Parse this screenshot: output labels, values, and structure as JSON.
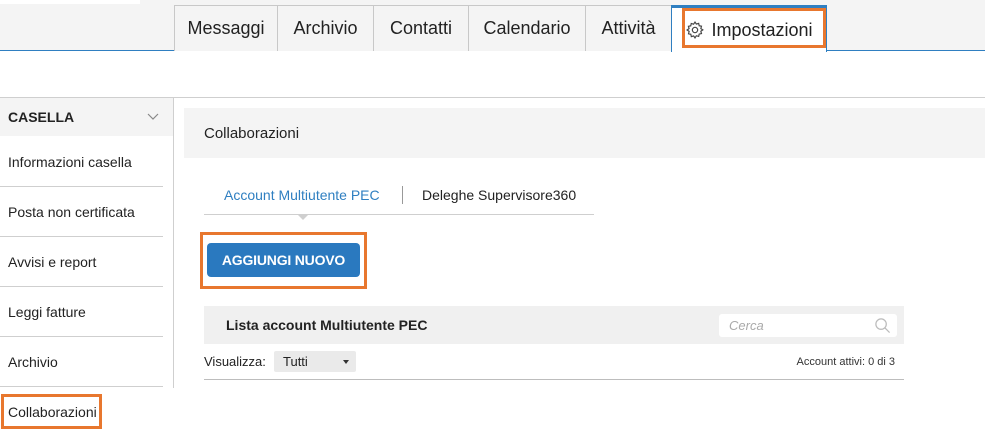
{
  "top_tabs": [
    {
      "label": "Messaggi"
    },
    {
      "label": "Archivio"
    },
    {
      "label": "Contatti"
    },
    {
      "label": "Calendario"
    },
    {
      "label": "Attività"
    },
    {
      "label": "Impostazioni",
      "icon": "gear-icon",
      "active": true
    }
  ],
  "sidebar": {
    "header": "CASELLA",
    "items": [
      {
        "label": "Informazioni casella"
      },
      {
        "label": "Posta non certificata"
      },
      {
        "label": "Avvisi e report"
      },
      {
        "label": "Leggi fatture"
      },
      {
        "label": "Archivio"
      },
      {
        "label": "Collaborazioni",
        "active": true
      }
    ]
  },
  "main": {
    "title": "Collaborazioni",
    "subtabs": [
      {
        "label": "Account Multiutente PEC",
        "active": true
      },
      {
        "label": "Deleghe Supervisore360"
      }
    ],
    "add_button": "AGGIUNGI NUOVO",
    "list": {
      "title": "Lista account Multiutente PEC",
      "search_placeholder": "Cerca",
      "filter_label": "Visualizza:",
      "filter_value": "Tutti",
      "count_text": "Account attivi: 0 di 3"
    }
  },
  "colors": {
    "accent": "#2f7fc1",
    "button": "#2a79bf",
    "highlight": "#e8772e"
  }
}
